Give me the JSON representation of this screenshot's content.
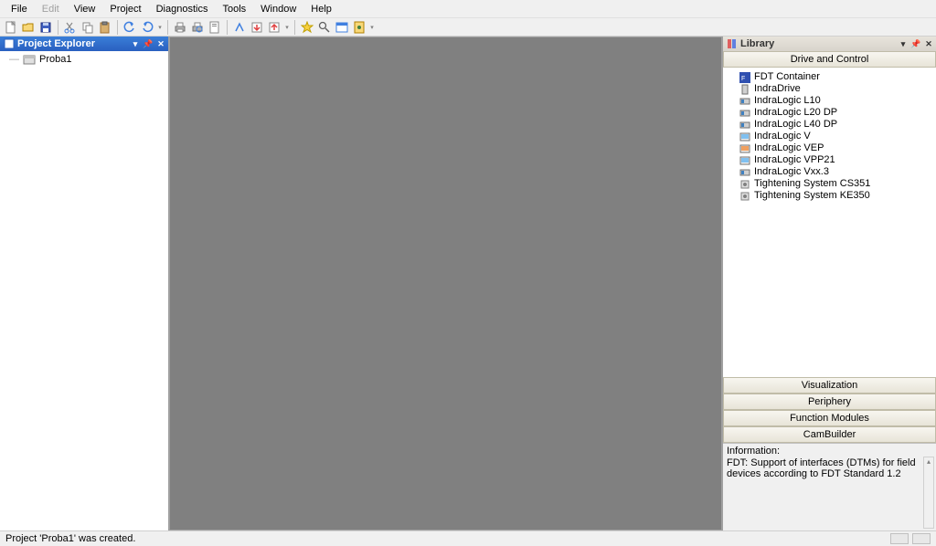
{
  "menu": {
    "items": [
      "File",
      "Edit",
      "View",
      "Project",
      "Diagnostics",
      "Tools",
      "Window",
      "Help"
    ],
    "disabled": [
      1
    ]
  },
  "project_explorer": {
    "title": "Project Explorer",
    "items": [
      {
        "label": "Proba1"
      }
    ]
  },
  "library": {
    "title": "Library",
    "categories": {
      "drive_and_control": "Drive and Control",
      "visualization": "Visualization",
      "periphery": "Periphery",
      "function_modules": "Function Modules",
      "cambuilder": "CamBuilder"
    },
    "items": [
      {
        "label": "FDT Container",
        "icon": "fdt"
      },
      {
        "label": "IndraDrive",
        "icon": "drive"
      },
      {
        "label": "IndraLogic L10",
        "icon": "logic"
      },
      {
        "label": "IndraLogic L20 DP",
        "icon": "logic"
      },
      {
        "label": "IndraLogic L40 DP",
        "icon": "logic"
      },
      {
        "label": "IndraLogic V",
        "icon": "logic-v"
      },
      {
        "label": "IndraLogic VEP",
        "icon": "logic-v"
      },
      {
        "label": "IndraLogic VPP21",
        "icon": "logic-v"
      },
      {
        "label": "IndraLogic Vxx.3",
        "icon": "logic"
      },
      {
        "label": "Tightening System CS351",
        "icon": "tight"
      },
      {
        "label": "Tightening System KE350",
        "icon": "tight"
      }
    ],
    "info_label": "Information:",
    "info_text": "FDT: Support of interfaces (DTMs) for field devices according to FDT Standard 1.2"
  },
  "statusbar": {
    "message": "Project 'Proba1' was created."
  }
}
